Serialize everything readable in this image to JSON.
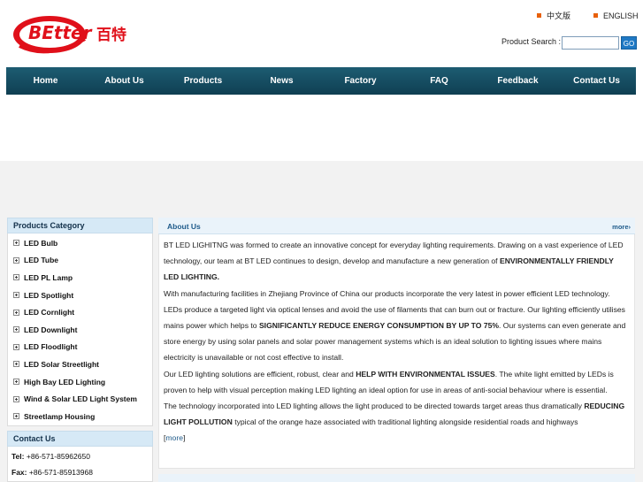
{
  "header": {
    "brand_text": "BEtter",
    "brand_cn": "百特",
    "lang_cn": "中文版",
    "lang_en": "ENGLISH",
    "search_label": "Product Search :",
    "search_value": "",
    "search_button": "GO",
    "colors": {
      "brand_red": "#e0101a",
      "accent_orange": "#e8600a"
    }
  },
  "nav": {
    "items": [
      "Home",
      "About Us",
      "Products",
      "News",
      "Factory",
      "FAQ",
      "Feedback",
      "Contact Us"
    ]
  },
  "sidebar": {
    "category_title": "Products Category",
    "categories": [
      "LED Bulb",
      "LED Tube",
      "LED PL Lamp",
      "LED Spotlight",
      "LED Cornlight",
      "LED Downlight",
      "LED Floodlight",
      "LED Solar Streetlight",
      "High Bay LED Lighting",
      "Wind & Solar LED Light System",
      "Streetlamp Housing"
    ],
    "contact_title": "Contact Us",
    "tel_label": "Tel:",
    "tel": "+86-571-85962650",
    "fax_label": "Fax:",
    "fax": "+86-571-85913968"
  },
  "about": {
    "title": "About Us",
    "more": "more›",
    "p1a": "BT LED LIGHITNG was formed to create an innovative concept for everyday lighting requirements. Drawing on a vast experience of LED technology, our team at BT LED continues to design, develop and manufacture a new generation of ",
    "p1b": "ENVIRONMENTALLY FRIENDLY LED LIGHTING.",
    "p2a": "With manufacturing facilities in Zhejiang Province of China our products incorporate the very latest in power efficient LED technology. LEDs produce a targeted light via optical lenses and avoid the use of filaments that can burn out or fracture. Our lighting efficiently utilises mains power which helps to ",
    "p2b": "SIGNIFICANTLY REDUCE ENERGY CONSUMPTION BY UP TO 75%",
    "p2c": ". Our systems can even generate and store energy by using solar panels and solar power management systems which is an ideal solution to lighting issues where mains electricity is unavailable or not cost effective to install.",
    "p3a": "Our LED lighting solutions are efficient, robust, clear and ",
    "p3b": "HELP WITH ENVIRONMENTAL ISSUES",
    "p3c": ". The white light emitted by LEDs is proven to help with visual perception making LED lighting an ideal option for use in areas of anti-social behaviour where is essential.",
    "p4a": "The technology incorporated into LED lighting allows the light produced to be directed towards target areas thus dramatically ",
    "p4b": "REDUCING LIGHT POLLUTION",
    "p4c": " typical of the orange haze associated with traditional lighting alongside residential roads and highways",
    "more_inline_open": "[",
    "more_inline": "more",
    "more_inline_close": "]"
  }
}
